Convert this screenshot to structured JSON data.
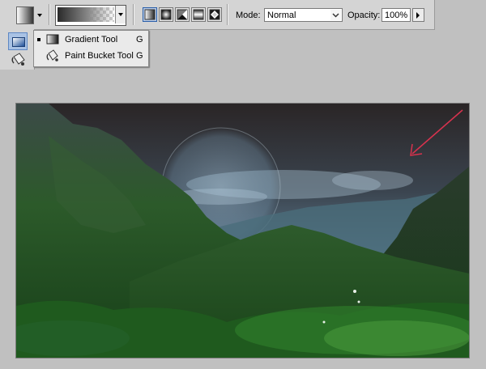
{
  "options_bar": {
    "mode_label": "Mode:",
    "mode_value": "Normal",
    "opacity_label": "Opacity:",
    "opacity_value": "100%",
    "gradient_types": [
      "linear",
      "radial",
      "angle",
      "reflected",
      "diamond"
    ],
    "active_gradient_type": "linear"
  },
  "tool_flyout": {
    "items": [
      {
        "label": "Gradient Tool",
        "shortcut": "G",
        "icon": "gradient-tool-icon",
        "selected": true
      },
      {
        "label": "Paint Bucket Tool",
        "shortcut": "G",
        "icon": "paint-bucket-icon",
        "selected": false
      }
    ]
  },
  "canvas": {
    "annotation": "red-arrow-pointing-down-left",
    "colors": {
      "annotation_arrow": "#d8324e",
      "sky_top": "#2a2526",
      "foliage": "#1f5a1e"
    }
  }
}
